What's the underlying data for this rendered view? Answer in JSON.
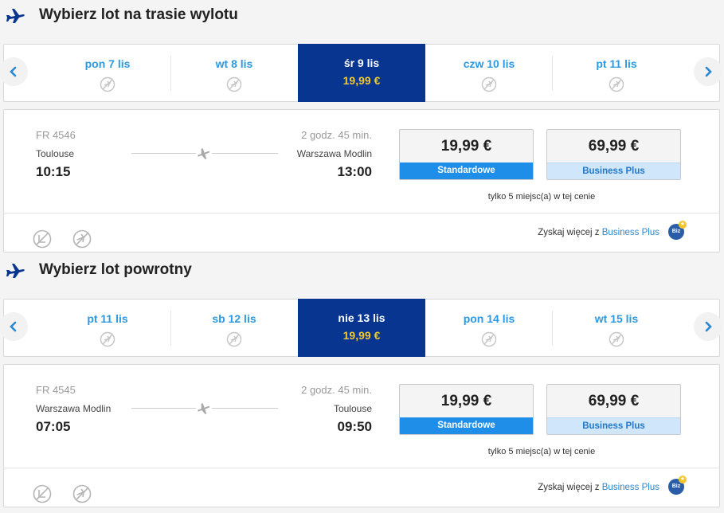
{
  "outbound": {
    "title": "Wybierz lot na trasie wylotu",
    "dates": [
      {
        "label": "pon 7 lis",
        "price": null,
        "selected": false
      },
      {
        "label": "wt 8 lis",
        "price": null,
        "selected": false
      },
      {
        "label": "śr 9 lis",
        "price": "19,99 €",
        "selected": true
      },
      {
        "label": "czw 10 lis",
        "price": null,
        "selected": false
      },
      {
        "label": "pt 11 lis",
        "price": null,
        "selected": false
      }
    ],
    "flight": {
      "number": "FR 4546",
      "from": "Toulouse",
      "departure": "10:15",
      "duration": "2 godz. 45 min.",
      "to": "Warszawa Modlin",
      "arrival": "13:00"
    },
    "fares": {
      "standard_price": "19,99 €",
      "standard_name": "Standardowe",
      "business_price": "69,99 €",
      "business_name": "Business Plus"
    },
    "note": "tylko 5 miejsc(a) w tej cenie",
    "upsell_text": "Zyskaj więcej z ",
    "upsell_link": "Business Plus",
    "badge": "Biz"
  },
  "return": {
    "title": "Wybierz lot powrotny",
    "dates": [
      {
        "label": "pt 11 lis",
        "price": null,
        "selected": false
      },
      {
        "label": "sb 12 lis",
        "price": null,
        "selected": false
      },
      {
        "label": "nie 13 lis",
        "price": "19,99 €",
        "selected": true
      },
      {
        "label": "pon 14 lis",
        "price": null,
        "selected": false
      },
      {
        "label": "wt 15 lis",
        "price": null,
        "selected": false
      }
    ],
    "flight": {
      "number": "FR 4545",
      "from": "Warszawa Modlin",
      "departure": "07:05",
      "duration": "2 godz. 45 min.",
      "to": "Toulouse",
      "arrival": "09:50"
    },
    "fares": {
      "standard_price": "19,99 €",
      "standard_name": "Standardowe",
      "business_price": "69,99 €",
      "business_name": "Business Plus"
    },
    "note": "tylko 5 miejsc(a) w tej cenie",
    "upsell_text": "Zyskaj więcej z ",
    "upsell_link": "Business Plus",
    "badge": "Biz"
  },
  "colors": {
    "brand_navy": "#073590",
    "link_blue": "#2c99e0",
    "price_yellow": "#f1c933",
    "standard_blue": "#1e8ee8"
  }
}
